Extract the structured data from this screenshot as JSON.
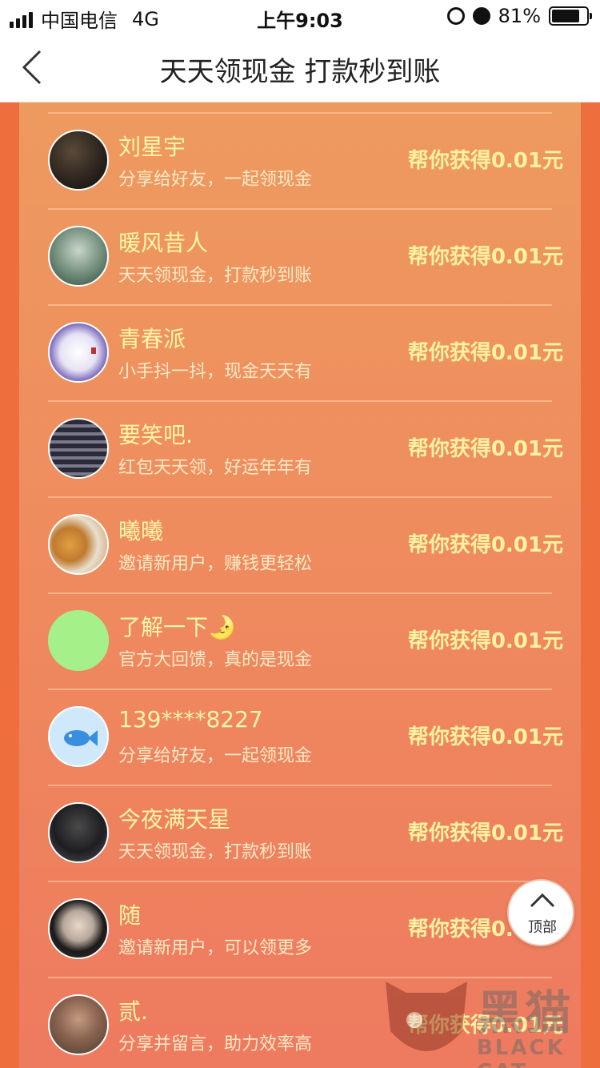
{
  "status": {
    "carrier": "中国电信",
    "network": "4G",
    "time": "上午9:03",
    "battery": "81%"
  },
  "nav": {
    "title": "天天领现金 打款秒到账"
  },
  "colors": {
    "panel_top": "#ee9a5f",
    "panel_bottom": "#ee7a5f",
    "name_color": "#fff6a8",
    "reward_color": "#fff2a0"
  },
  "items": [
    {
      "name": "刘星宇",
      "desc": "分享给好友，一起领现金",
      "reward": "帮你获得0.01元",
      "avatar": "photo-avatar"
    },
    {
      "name": "暖风昔人",
      "desc": "天天领现金，打款秒到账",
      "reward": "帮你获得0.01元",
      "avatar": "photo-avatar"
    },
    {
      "name": "青春派",
      "desc": "小手抖一抖，现金天天有",
      "reward": "帮你获得0.01元",
      "avatar": "seal-avatar"
    },
    {
      "name": "要笑吧.",
      "desc": "红包天天领，好运年年有",
      "reward": "帮你获得0.01元",
      "avatar": "photo-avatar"
    },
    {
      "name": "曦曦",
      "desc": "邀请新用户，赚钱更轻松",
      "reward": "帮你获得0.01元",
      "avatar": "dog-avatar"
    },
    {
      "name": "了解一下🌛",
      "desc": "官方大回馈，真的是现金",
      "reward": "帮你获得0.01元",
      "avatar": "green-avatar"
    },
    {
      "name": "139****8227",
      "desc": "分享给好友，一起领现金",
      "reward": "帮你获得0.01元",
      "avatar": "fish-avatar"
    },
    {
      "name": "今夜满天星",
      "desc": "天天领现金，打款秒到账",
      "reward": "帮你获得0.01元",
      "avatar": "photo-avatar"
    },
    {
      "name": "随",
      "desc": "邀请新用户，可以领更多",
      "reward": "帮你获得0.01元",
      "avatar": "photo-avatar"
    },
    {
      "name": "贰.",
      "desc": "分享并留言，助力效率高",
      "reward": "帮你获得0.01元",
      "avatar": "photo-avatar"
    }
  ],
  "top_button": {
    "label": "顶部"
  },
  "watermark": {
    "cn": "黑猫",
    "en": "BLACK CAT"
  }
}
